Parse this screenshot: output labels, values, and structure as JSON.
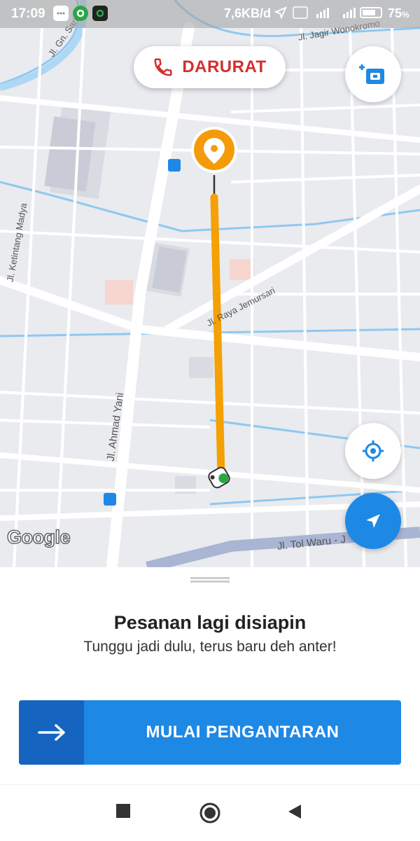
{
  "status_bar": {
    "time": "17:09",
    "network_speed": "7,6KB/d",
    "battery_percent": "75",
    "battery_unit": "%"
  },
  "map": {
    "emergency_label": "DARURAT",
    "road_labels": {
      "gn_sari": "Jl. Gn. Sari",
      "ketintang": "Jl. Ketintang Madya",
      "ahmad_yani": "Jl. Ahmad Yani",
      "raya_jemursari": "Jl. Raya Jemursari",
      "tol_waru": "Jl. Tol Waru - J",
      "wonokromo": "Jl. Jagir Wonokromo"
    },
    "attribution": "Google",
    "route_color": "#f5a005",
    "pin_color": "#f59b0a"
  },
  "sheet": {
    "title": "Pesanan lagi disiapin",
    "subtitle": "Tunggu jadi dulu, terus baru deh anter!",
    "cta_label": "MULAI PENGANTARAN"
  },
  "colors": {
    "accent": "#1e88e5",
    "accent_dark": "#1565c0",
    "danger": "#d32f2f"
  }
}
